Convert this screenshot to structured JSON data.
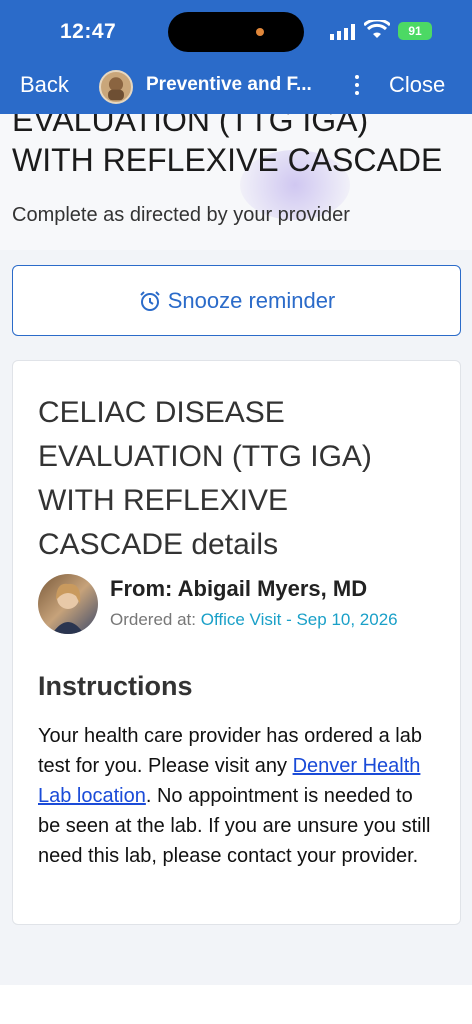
{
  "status_bar": {
    "time": "12:47",
    "battery": "91"
  },
  "nav": {
    "back_label": "Back",
    "title": "Preventive and F...",
    "close_label": "Close"
  },
  "header": {
    "title": "EVALUATION (TTG IGA) WITH REFLEXIVE CASCADE",
    "subtitle": "Complete as directed by your provider"
  },
  "snooze": {
    "label": "Snooze reminder",
    "icon": "alarm-clock-icon"
  },
  "card": {
    "title": "CELIAC DISEASE EVALUATION (TTG IGA) WITH REFLEXIVE CASCADE details",
    "from": "From: Abigail Myers, MD",
    "ordered_prefix": "Ordered at:",
    "ordered_link": "Office Visit - Sep 10, 2026",
    "instructions_heading": "Instructions",
    "instructions_before": "Your health care provider has ordered a lab test for you. Please visit any ",
    "instructions_link": "Denver Health Lab location",
    "instructions_after": ". No appointment is needed to be seen at the lab. If you are unsure you still need this lab, please contact your provider."
  },
  "colors": {
    "brand": "#2b6bc9",
    "link": "#1a4bd8",
    "visit_link": "#1aa0c8"
  }
}
